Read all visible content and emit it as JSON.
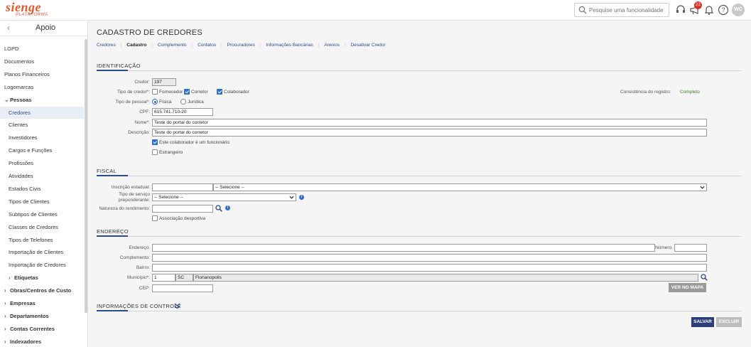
{
  "brand": {
    "logo_text": "sienge",
    "logo_sub": "PLATAFORMA"
  },
  "header": {
    "search_placeholder": "Pesquise uma funcionalidade",
    "notifications_count": "22",
    "avatar_initials": "WC"
  },
  "sidebar": {
    "title": "Apoio",
    "back": "‹",
    "items": [
      {
        "label": "LGPD",
        "level": 0,
        "expand": ""
      },
      {
        "label": "Documentos",
        "level": 0,
        "expand": ""
      },
      {
        "label": "Planos Financeiros",
        "level": 0,
        "expand": ""
      },
      {
        "label": "Logomarcas",
        "level": 0,
        "expand": ""
      },
      {
        "label": "Pessoas",
        "level": 0,
        "expand": "open",
        "bold": true
      },
      {
        "label": "Credores",
        "level": 1,
        "active": true
      },
      {
        "label": "Clientes",
        "level": 1
      },
      {
        "label": "Investidores",
        "level": 1
      },
      {
        "label": "Cargos e Funções",
        "level": 1
      },
      {
        "label": "Profissões",
        "level": 1
      },
      {
        "label": "Atividades",
        "level": 1
      },
      {
        "label": "Estados Civis",
        "level": 1
      },
      {
        "label": "Tipos de Clientes",
        "level": 1
      },
      {
        "label": "Subtipos de Clientes",
        "level": 1
      },
      {
        "label": "Classes de Credores",
        "level": 1
      },
      {
        "label": "Tipos de Telefones",
        "level": 1
      },
      {
        "label": "Importação de Clientes",
        "level": 1
      },
      {
        "label": "Importação de Credores",
        "level": 1
      },
      {
        "label": "Etiquetas",
        "level": 1,
        "expand": "closed",
        "bold": true
      },
      {
        "label": "Obras/Centros de Custo",
        "level": 0,
        "expand": "closed",
        "bold": true
      },
      {
        "label": "Empresas",
        "level": 0,
        "expand": "closed",
        "bold": true
      },
      {
        "label": "Departamentos",
        "level": 0,
        "expand": "closed",
        "bold": true
      },
      {
        "label": "Contas Correntes",
        "level": 0,
        "expand": "closed",
        "bold": true
      },
      {
        "label": "Indexadores",
        "level": 0,
        "expand": "closed",
        "bold": true
      }
    ]
  },
  "page": {
    "title": "CADASTRO DE CREDORES",
    "tabs": [
      "Credores",
      "Cadastro",
      "Complemento",
      "Contatos",
      "Procuradores",
      "Informações Bancárias",
      "Anexos",
      "Desativar Credor"
    ],
    "active_tab": "Cadastro"
  },
  "identificacao": {
    "section_title": "IDENTIFICAÇÃO",
    "credor_label": "Credor:",
    "credor_value": "197",
    "tipo_credor_label": "Tipo de credor*:",
    "tipo_credor_options": [
      {
        "label": "Fornecedor",
        "checked": false
      },
      {
        "label": "Corretor",
        "checked": true
      },
      {
        "label": "Colaborador",
        "checked": true
      }
    ],
    "consistencia_label": "Consistência do registro:",
    "consistencia_value": "Completo",
    "tipo_pessoa_label": "Tipo de pessoa*:",
    "tipo_pessoa_options": [
      {
        "label": "Física",
        "checked": true
      },
      {
        "label": "Jurídica",
        "checked": false
      }
    ],
    "cpf_label": "CPF:",
    "cpf_value": "615.741.710-20",
    "nome_label": "Nome*:",
    "nome_value": "Teste do portal do corretor",
    "descricao_label": "Descrição:",
    "descricao_value": "Teste do portal do corretor",
    "funcionario_label": "Este colaborador é um funcionário",
    "funcionario_checked": true,
    "estrangeiro_label": "Estrangeiro",
    "estrangeiro_checked": false
  },
  "fiscal": {
    "section_title": "FISCAL",
    "inscricao_label": "Inscrição estadual:",
    "inscricao_value": "",
    "inscricao_select": "-- Selecione --",
    "tipo_servico_label_1": "Tipo de serviço",
    "tipo_servico_label_2": "preponderante:",
    "tipo_servico_select": "-- Selecione --",
    "natureza_label": "Natureza do rendimento:",
    "natureza_value": "",
    "associacao_label": "Associação desportiva",
    "associacao_checked": false
  },
  "endereco": {
    "section_title": "ENDEREÇO",
    "endereco_label": "Endereço:",
    "endereco_value": "",
    "numero_label": "Número:",
    "numero_value": "",
    "complemento_label": "Complemento:",
    "complemento_value": "",
    "bairro_label": "Bairro:",
    "bairro_value": "",
    "municipio_label": "Município*:",
    "municipio_code": "1",
    "municipio_uf": "SC",
    "municipio_name": "Florianopolis",
    "cep_label": "CEP:",
    "cep_value": "",
    "ver_mapa": "VER NO MAPA"
  },
  "controle": {
    "section_title": "INFORMAÇÕES DE CONTROLE"
  },
  "actions": {
    "salvar": "SALVAR",
    "excluir": "EXCLUIR"
  },
  "colors": {
    "primary": "#2c4c85",
    "accent": "#2f6fd0",
    "brand": "#e4572e",
    "ok": "#3a7d2c"
  }
}
